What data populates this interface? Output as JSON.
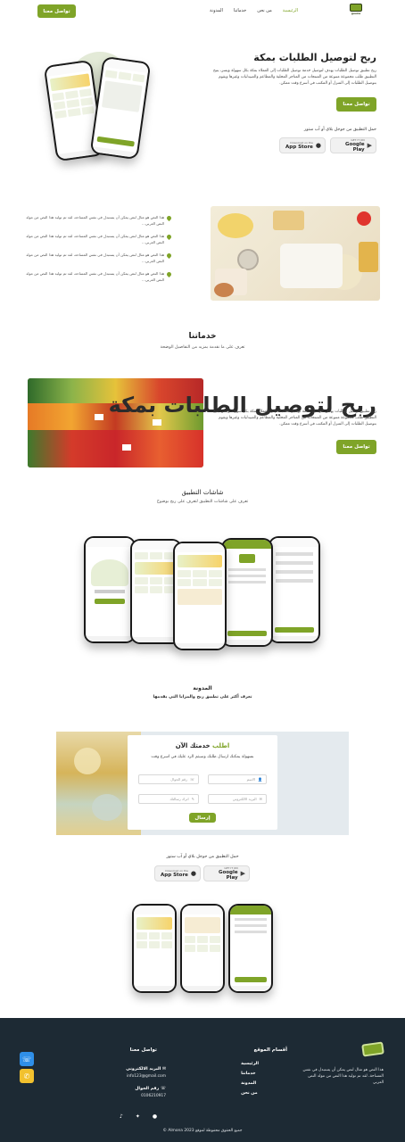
{
  "header": {
    "logo_text": "geena",
    "nav": [
      "الرئيسية",
      "من نحن",
      "خدماتنا",
      "المدونة"
    ],
    "cta": "تواصل معنا"
  },
  "hero": {
    "title": "ربح لتوصيل الطلبات بمكة",
    "desc": "ربح تطبيق توصيل الطلبات يهدف لتوصيل خدمة توصيل الطلبات إلى العملاء بمكة بكل سهولة ويسر، يتيح التطبيق طلب مجموعة متنوعة من المنتجات من المتاجر المحلية والمطاعم والصيدليات وغيرها ويقوم بتوصيل الطلبات إلى المنزل أو المكتب في أسرع وقت ممكن.",
    "cta": "تواصل معنا",
    "download_label": "حمل التطبيق من جوجل بلاي أو آب ستور",
    "app_store_small": "Download on the",
    "app_store_big": "App Store",
    "play_small": "GET IT ON",
    "play_big": "Google Play"
  },
  "features": {
    "items": [
      "هذا النص هو مثال لنص يمكن أن يستبدل في نفس المساحة، لقد تم توليد هذا النص من مولد النص العربي...",
      "هذا النص هو مثال لنص يمكن أن يستبدل في نفس المساحة، لقد تم توليد هذا النص من مولد النص العربي...",
      "هذا النص هو مثال لنص يمكن أن يستبدل في نفس المساحة، لقد تم توليد هذا النص من مولد النص العربي...",
      "هذا النص هو مثال لنص يمكن أن يستبدل في نفس المساحة، لقد تم توليد هذا النص من مولد النص العربي..."
    ]
  },
  "services": {
    "title": "خدماتنا",
    "subtitle": "تعرف على ما نقدمة بمزيد من التفاصيل الوضحة",
    "card_title": "ربح لتوصيل الطلبات بمكة",
    "card_desc": "ربح تطبيق توصيل الطلبات يهدف لتوصيل خدمة توصيل الطلبات إلى العملاء بمكة بكل سهولة ويسر، يتيح التطبيق طلب مجموعة متنوعة من المنتجات من المتاجر المحلية والمطاعم والصيدليات وغيرها ويقوم بتوصيل الطلبات إلى المنزل أو المكتب في أسرع وقت ممكن.",
    "cta": "تواصل معنا"
  },
  "screens": {
    "title": "شاشات التطبيق",
    "subtitle": "تعرف على شاشات التطبيق لتعرف على ربح بوضوح"
  },
  "blog": {
    "title": "المدونة",
    "subtitle": "تعرف أكثر على تطبيق ربح والمزايا التي يقدمها"
  },
  "form": {
    "title_accent": "اطلب",
    "title_rest": "خدمتك الآن",
    "subtitle": "بسهولة يمكنك ارسال طلبك وسيتم الرد عليك في اسرع وقت",
    "name": "الاسم",
    "phone": "رقم الجوال",
    "email": "البريد الالكتروني",
    "message": "اترك رسالتك",
    "submit": "إرسال"
  },
  "download2": {
    "label": "حمل التطبيق من جوجل بلاي أو آب ستور",
    "app_store_small": "Download on the",
    "app_store_big": "App Store",
    "play_small": "GET IT ON",
    "play_big": "Google Play"
  },
  "footer": {
    "about": "هذا النص هو مثال لنص يمكن أن يستبدل في نفس المساحة، لقد تم توليد هذا النص من مولد النص العربي",
    "sections_title": "أقسام الموقع",
    "links": [
      "الرئيسية",
      "خدماتنا",
      "المدونة",
      "من نحن"
    ],
    "contact_title": "تواصل معنا",
    "email_label": "البريد الالكتروني",
    "email_value": "info123@gmail.com",
    "phone_label": "رقم الجوال",
    "phone_value": "0106210917",
    "copyright": "جميع الحقوق محفوظة لموقع Almona 2023 ©"
  },
  "colors": {
    "accent": "#7fa428",
    "footer_bg": "#1d2a34",
    "float_blue": "#2f8fe8",
    "float_yellow": "#f2c12e"
  }
}
